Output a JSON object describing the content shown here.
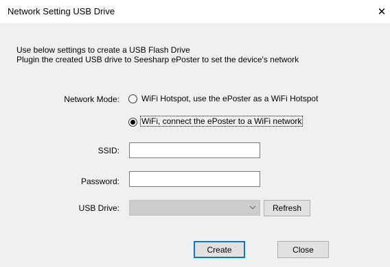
{
  "window": {
    "title": "Network Setting USB Drive",
    "close_glyph": "✕"
  },
  "description": {
    "line1": "Use below settings to create a USB Flash Drive",
    "line2": "Plugin the created USB drive to Seesharp ePoster to set the device's network"
  },
  "network_mode": {
    "label": "Network Mode:",
    "options": [
      {
        "label": "WiFi Hotspot, use the ePoster as a WiFi Hotspot",
        "checked": false
      },
      {
        "label": "WiFi, connect the ePoster to a WiFi network",
        "checked": true
      }
    ]
  },
  "ssid": {
    "label": "SSID:",
    "value": ""
  },
  "password": {
    "label": "Password:",
    "value": ""
  },
  "usb_drive": {
    "label": "USB Drive:",
    "selected": "",
    "enabled": false,
    "refresh_label": "Refresh",
    "arrow_icon": "chevron-down-icon"
  },
  "buttons": {
    "create_label": "Create",
    "close_label": "Close"
  },
  "colors": {
    "dialog_bg": "#f0f0f0",
    "titlebar_bg": "#ffffff",
    "button_bg": "#e1e1e1",
    "default_button_border": "#0078d7",
    "disabled_combo_bg": "#cccccc"
  }
}
